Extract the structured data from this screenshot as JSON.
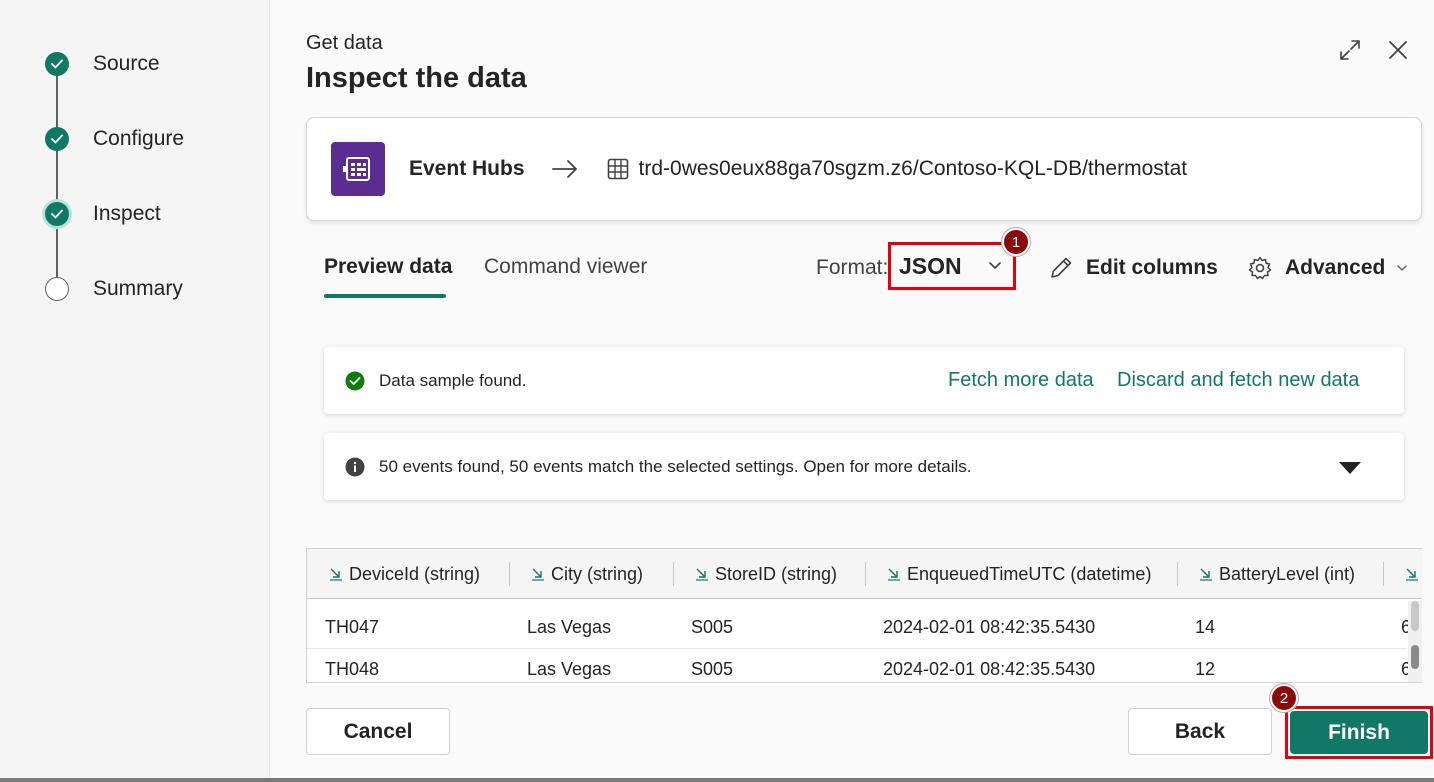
{
  "wizard": {
    "steps": [
      {
        "label": "Source",
        "state": "done"
      },
      {
        "label": "Configure",
        "state": "done"
      },
      {
        "label": "Inspect",
        "state": "current"
      },
      {
        "label": "Summary",
        "state": "todo"
      }
    ]
  },
  "header": {
    "supertitle": "Get data",
    "title": "Inspect the data",
    "expand_icon": "expand-icon",
    "close_icon": "close-icon"
  },
  "source": {
    "icon": "event-hubs-icon",
    "name": "Event Hubs",
    "arrow_icon": "arrow-right-icon",
    "table_icon": "table-icon",
    "destination": "trd-0wes0eux88ga70sgzm.z6/Contoso-KQL-DB/thermostat"
  },
  "tabs": [
    {
      "label": "Preview data",
      "active": true
    },
    {
      "label": "Command viewer",
      "active": false
    }
  ],
  "toolbar": {
    "format_label": "Format:",
    "format_value": "JSON",
    "edit_columns_label": "Edit columns",
    "advanced_label": "Advanced"
  },
  "annotations": {
    "badge_1": "1",
    "badge_2": "2"
  },
  "messages": {
    "sample_found": "Data sample found.",
    "fetch_more": "Fetch more data",
    "discard_fetch": "Discard and fetch new data",
    "events_info": "50 events found, 50 events match the selected settings. Open for more details."
  },
  "grid": {
    "columns": [
      "DeviceId (string)",
      "City (string)",
      "StoreID (string)",
      "EnqueuedTimeUTC (datetime)",
      "BatteryLevel (int)"
    ],
    "rows": [
      [
        "TH047",
        "Las Vegas",
        "S005",
        "2024-02-01 08:42:35.5430",
        "14",
        "6"
      ],
      [
        "TH048",
        "Las Vegas",
        "S005",
        "2024-02-01 08:42:35.5430",
        "12",
        "6"
      ]
    ]
  },
  "footer": {
    "cancel_label": "Cancel",
    "back_label": "Back",
    "finish_label": "Finish"
  },
  "colors": {
    "accent": "#117865",
    "highlight": "#e3000f",
    "badge": "#8b0a0a",
    "event_hubs": "#5c2d91"
  }
}
